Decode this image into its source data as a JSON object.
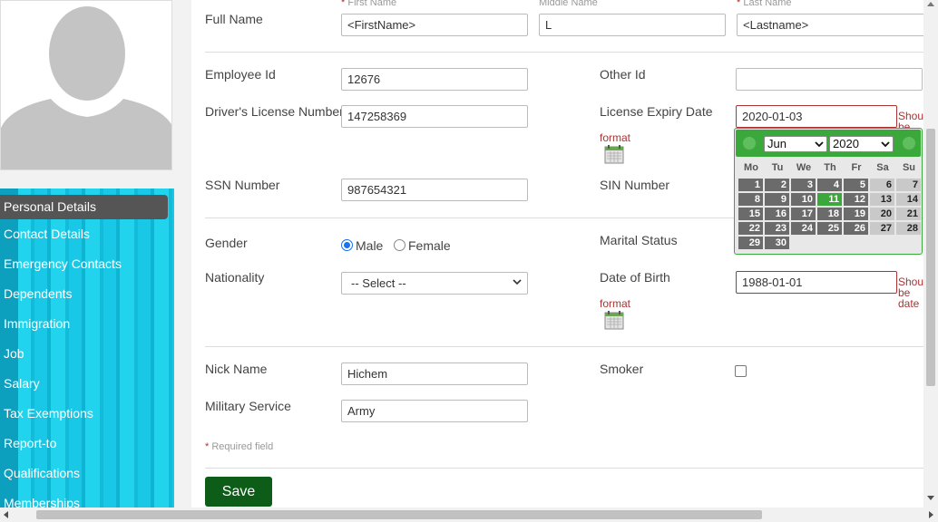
{
  "sidebar": {
    "items": [
      {
        "label": "Personal Details"
      },
      {
        "label": "Contact Details"
      },
      {
        "label": "Emergency Contacts"
      },
      {
        "label": "Dependents"
      },
      {
        "label": "Immigration"
      },
      {
        "label": "Job"
      },
      {
        "label": "Salary"
      },
      {
        "label": "Tax Exemptions"
      },
      {
        "label": "Report-to"
      },
      {
        "label": "Qualifications"
      },
      {
        "label": "Memberships"
      }
    ]
  },
  "form": {
    "full_name_label": "Full Name",
    "first_name_label": "First Name",
    "middle_name_label": "Middle Name",
    "last_name_label": "Last Name",
    "required_mark": "*",
    "first_name_value": "<FirstName>",
    "middle_name_value": "L",
    "last_name_value": "<Lastname>",
    "employee_id_label": "Employee Id",
    "employee_id_value": "12676",
    "other_id_label": "Other Id",
    "other_id_value": "",
    "license_label": "Driver's License Number",
    "license_value": "147258369",
    "license_expiry_label": "License Expiry Date",
    "license_expiry_value": "2020-01-03",
    "should_text": "Should be date",
    "format_text": "format",
    "ssn_label": "SSN Number",
    "ssn_value": "987654321",
    "sin_label": "SIN Number",
    "gender_label": "Gender",
    "gender_male": "Male",
    "gender_female": "Female",
    "marital_label": "Marital Status",
    "nationality_label": "Nationality",
    "nationality_value": "-- Select --",
    "dob_label": "Date of Birth",
    "dob_value": "1988-01-01",
    "nick_label": "Nick Name",
    "nick_value": "Hichem",
    "smoker_label": "Smoker",
    "military_label": "Military Service",
    "military_value": "Army",
    "required_note": "Required field",
    "save_label": "Save"
  },
  "datepicker": {
    "month": "Jun",
    "year": "2020",
    "weekdays": [
      "Mo",
      "Tu",
      "We",
      "Th",
      "Fr",
      "Sa",
      "Su"
    ],
    "days": [
      "1",
      "2",
      "3",
      "4",
      "5",
      "6",
      "7",
      "8",
      "9",
      "10",
      "11",
      "12",
      "13",
      "14",
      "15",
      "16",
      "17",
      "18",
      "19",
      "20",
      "21",
      "22",
      "23",
      "24",
      "25",
      "26",
      "27",
      "28",
      "29",
      "30"
    ],
    "highlighted_day": "11"
  },
  "colors": {
    "accent_green": "#3aa83a",
    "save_green": "#0d5c18",
    "sidebar_cyan": "#18c8e6",
    "error_red": "#a33"
  }
}
